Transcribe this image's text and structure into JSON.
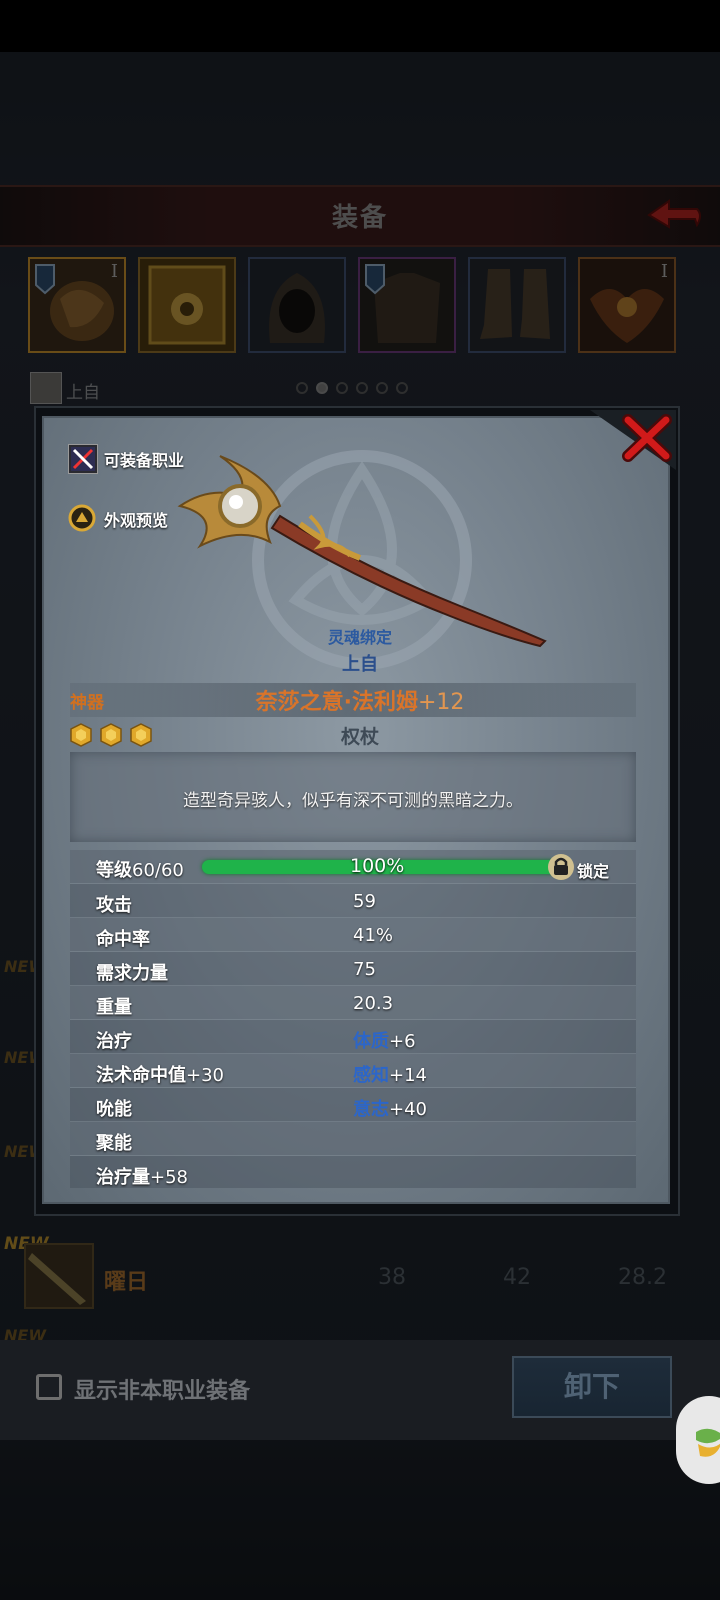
{
  "header": {
    "title": "装备"
  },
  "equipment_slots": [
    {
      "name": "helm-slot",
      "tier": "I"
    },
    {
      "name": "tome-slot",
      "tier": ""
    },
    {
      "name": "hood-slot",
      "tier": ""
    },
    {
      "name": "armor-slot",
      "tier": ""
    },
    {
      "name": "boots-slot",
      "tier": ""
    },
    {
      "name": "amulet-slot",
      "tier": "I"
    }
  ],
  "owner": {
    "name": "上自"
  },
  "page_dots": {
    "count": 6,
    "active": 1
  },
  "list_item": {
    "new_tag": "NEW",
    "name": "曜日",
    "values": [
      "38",
      "42",
      "28.2"
    ]
  },
  "side_new_tags": [
    "NEW",
    "NEW",
    "NEW",
    "NEW"
  ],
  "bottom": {
    "checkbox_label": "显示非本职业装备",
    "unequip_label": "卸下"
  },
  "modal": {
    "equippable_classes_label": "可装备职业",
    "appearance_preview_label": "外观预览",
    "soulbound_label": "灵魂绑定",
    "bound_owner": "上自",
    "rarity": "神器",
    "item_name": "奈莎之意·法利姆",
    "enhance": "+12",
    "item_type": "权杖",
    "gems": 3,
    "description": "造型奇异骇人，似乎有深不可测的黑暗之力。",
    "level": {
      "label": "等级",
      "value": "60/60",
      "percent_text": "100%",
      "fraction": 1.0,
      "lock_label": "锁定"
    },
    "stats": [
      {
        "label": "攻击",
        "value": "59"
      },
      {
        "label": "命中率",
        "value": "41%"
      },
      {
        "label": "需求力量",
        "value": "75"
      },
      {
        "label": "重量",
        "value": "20.3"
      },
      {
        "label": "治疗",
        "value_name": "体质",
        "value_bonus": "+6"
      },
      {
        "label": "法术命中值",
        "label_bonus": "+30",
        "value_name": "感知",
        "value_bonus": "+14"
      },
      {
        "label": "吮能",
        "value_name": "意志",
        "value_bonus": "+40"
      },
      {
        "label": "聚能"
      },
      {
        "label": "治疗量",
        "label_bonus": "+58"
      }
    ]
  },
  "colors": {
    "accent_orange": "#d9742a",
    "stat_blue": "#2c66c9",
    "level_green": "#1fb34a",
    "close_red": "#d11a1a"
  }
}
